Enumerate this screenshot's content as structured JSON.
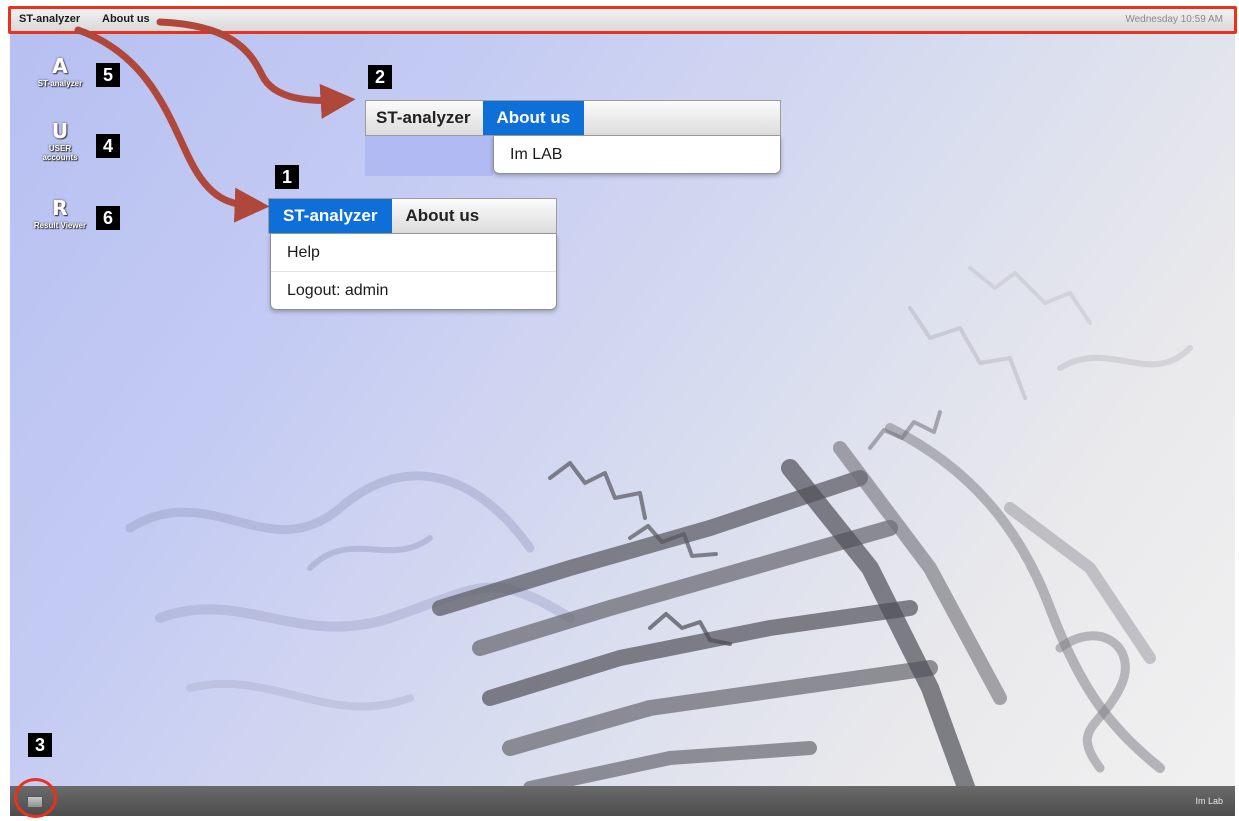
{
  "menubar": {
    "items": [
      "ST-analyzer",
      "About us"
    ],
    "clock": "Wednesday 10:59 AM"
  },
  "desktop_icons": [
    {
      "label": "ST-analyzer",
      "icon": "st-analyzer-icon",
      "glyph": "A",
      "badge": "5"
    },
    {
      "label": "USER accounts",
      "icon": "user-accounts-icon",
      "glyph": "U",
      "badge": "4"
    },
    {
      "label": "Result Viewer",
      "icon": "result-viewer-icon",
      "glyph": "R",
      "badge": "6"
    }
  ],
  "callout_menu_1": {
    "badge": "1",
    "tabs": [
      "ST-analyzer",
      "About us"
    ],
    "active_tab": "ST-analyzer",
    "items": [
      "Help",
      "Logout: admin"
    ]
  },
  "callout_menu_2": {
    "badge": "2",
    "tabs": [
      "ST-analyzer",
      "About us"
    ],
    "active_tab": "About us",
    "items": [
      "Im LAB"
    ]
  },
  "taskbar": {
    "badge": "3",
    "start_icon": "window-list-icon",
    "brand": "Im Lab"
  },
  "colors": {
    "highlight": "#e8321e",
    "active_tab": "#0f6fd9",
    "arrow": "#b0473b"
  }
}
